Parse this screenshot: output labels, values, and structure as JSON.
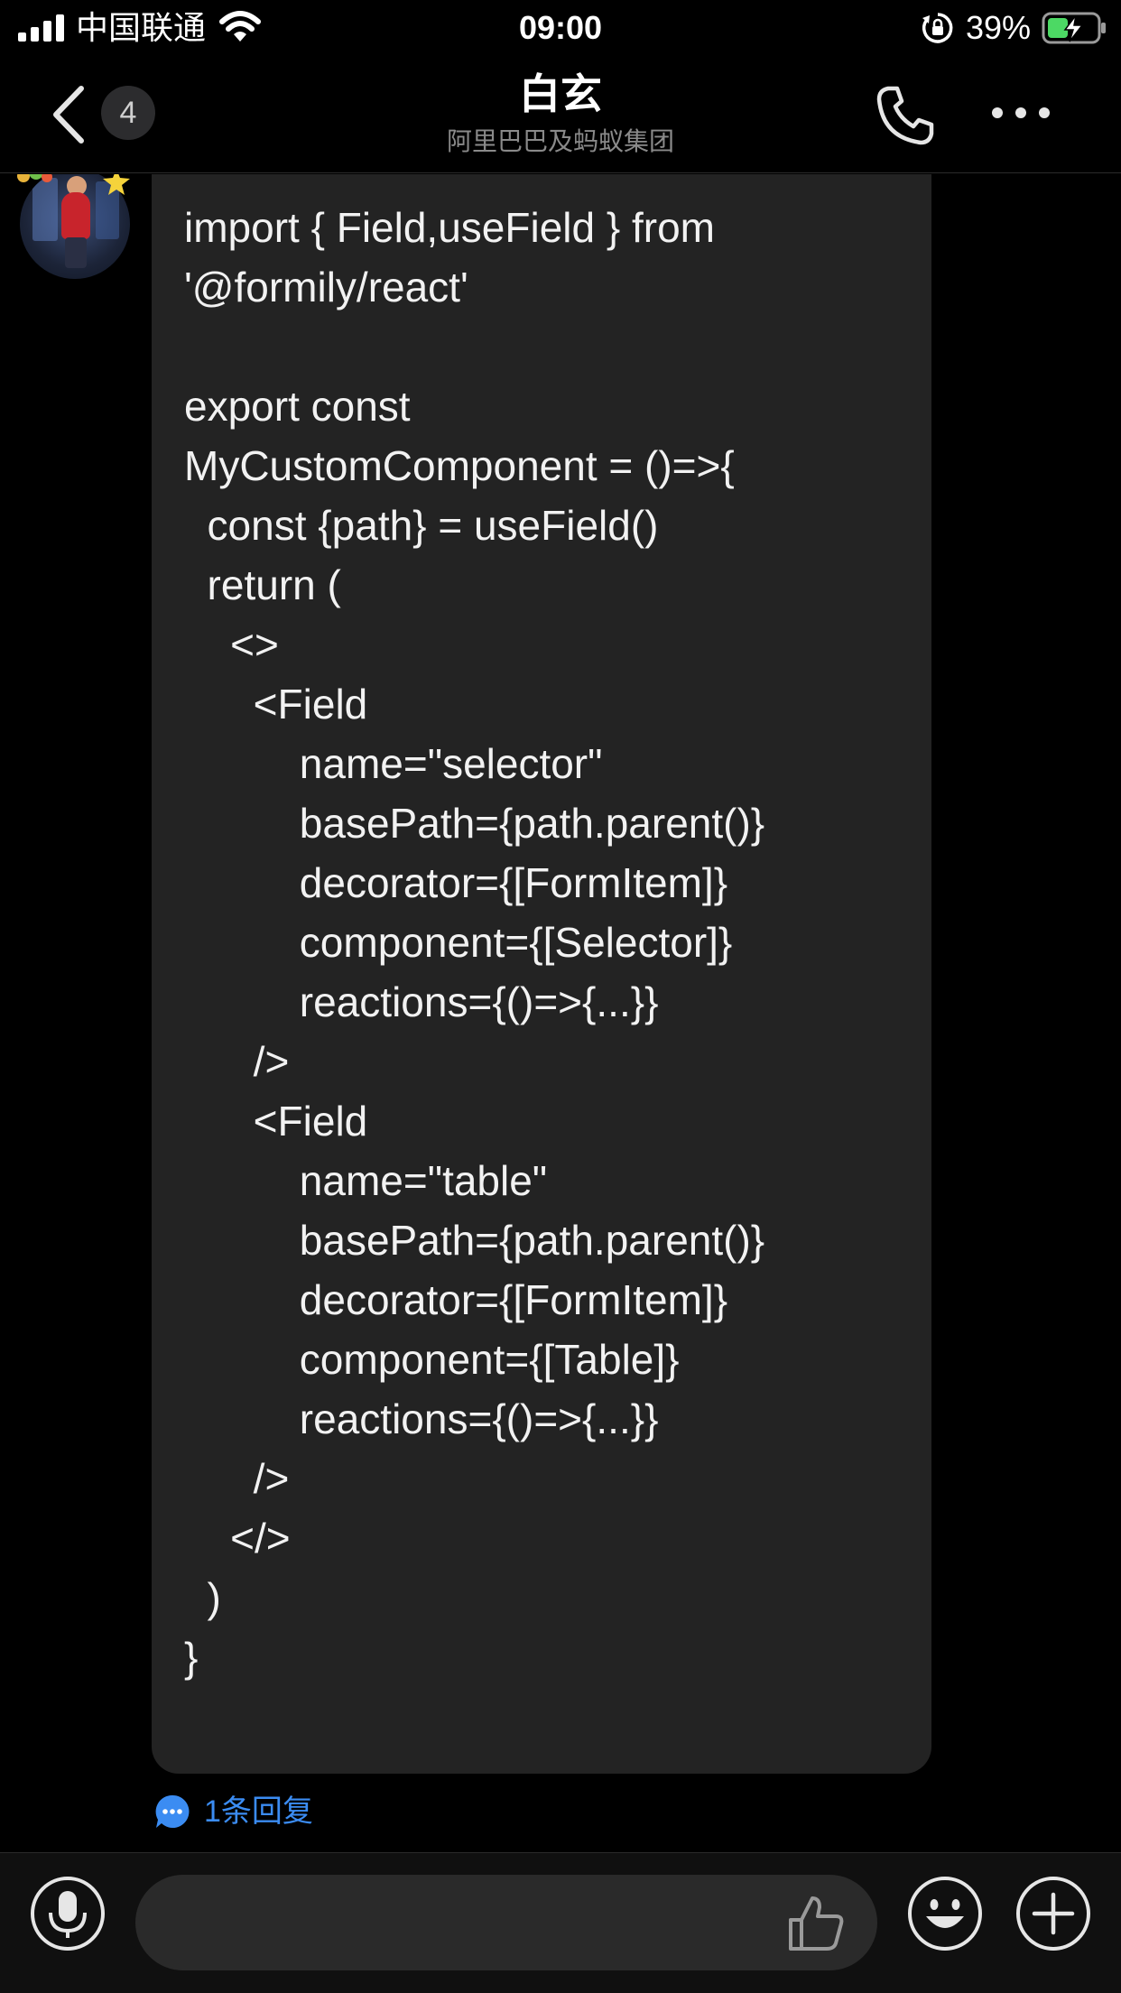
{
  "status_bar": {
    "carrier": "中国联通",
    "time": "09:00",
    "battery_percent": "39%",
    "signal_bars": 4,
    "icons": [
      "signal-icon",
      "wifi-icon",
      "rotation-lock-icon",
      "battery-charging-icon"
    ]
  },
  "nav": {
    "unread_count": "4",
    "title": "白玄",
    "subtitle": "阿里巴巴及蚂蚁集团",
    "icons": [
      "back-icon",
      "phone-icon",
      "more-icon"
    ]
  },
  "message": {
    "code_lines": [
      "import { Field,useField } from",
      "'@formily/react'",
      "",
      "export const",
      "MyCustomComponent = ()=>{",
      "  const {path} = useField()",
      "  return (",
      "    <>",
      "      <Field",
      "          name=\"selector\"",
      "          basePath={path.parent()}",
      "          decorator={[FormItem]}",
      "          component={[Selector]}",
      "          reactions={()=>{...}}",
      "      />",
      "      <Field",
      "          name=\"table\"",
      "          basePath={path.parent()}",
      "          decorator={[FormItem]}",
      "          component={[Table]}",
      "          reactions={()=>{...}}",
      "      />",
      "    </>",
      "  )",
      "}"
    ],
    "reply_label": "1条回复"
  },
  "input_bar": {
    "placeholder": "",
    "icons": [
      "microphone-icon",
      "thumbs-up-icon",
      "emoji-icon",
      "plus-icon"
    ]
  },
  "colors": {
    "background": "#000000",
    "bubble": "#232323",
    "link": "#3b8cf2",
    "input": "#2a2a2a",
    "battery_charge": "#4cd964"
  }
}
